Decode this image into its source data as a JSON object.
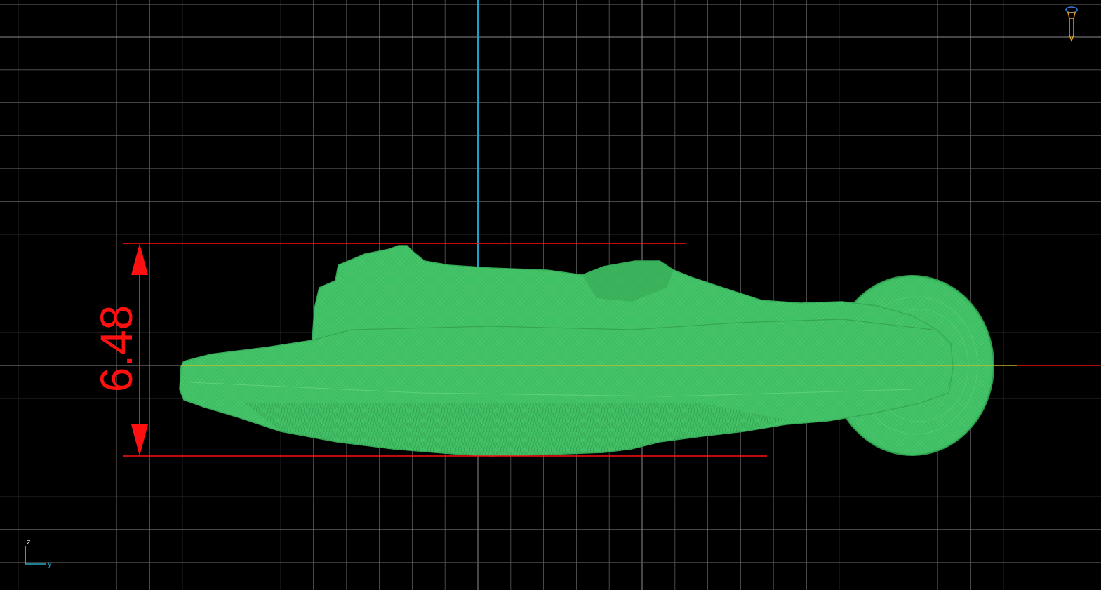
{
  "viewport": {
    "view": "side",
    "background_color": "#000000",
    "grid_color": "#5a5a5a",
    "grid_major_color": "#8c8c8c",
    "vertical_axis_color": "#1aa3c8",
    "horizontal_axis_color": "#e01010",
    "ground_line_color": "#d8c020"
  },
  "model": {
    "name": "",
    "mesh_color": "#3fbf63",
    "mesh_dark": "#2f9a4c",
    "wireframe_color": "#7fe09a"
  },
  "dimension": {
    "value": "6.48",
    "color": "#ff1010"
  },
  "axis_gizmo": {
    "up_label": "z",
    "right_label": "y",
    "up_color": "#d8b040",
    "right_color": "#2aa8c8"
  },
  "corner_icon": {
    "icon": "camera-light-icon",
    "color": "#d8a020"
  }
}
